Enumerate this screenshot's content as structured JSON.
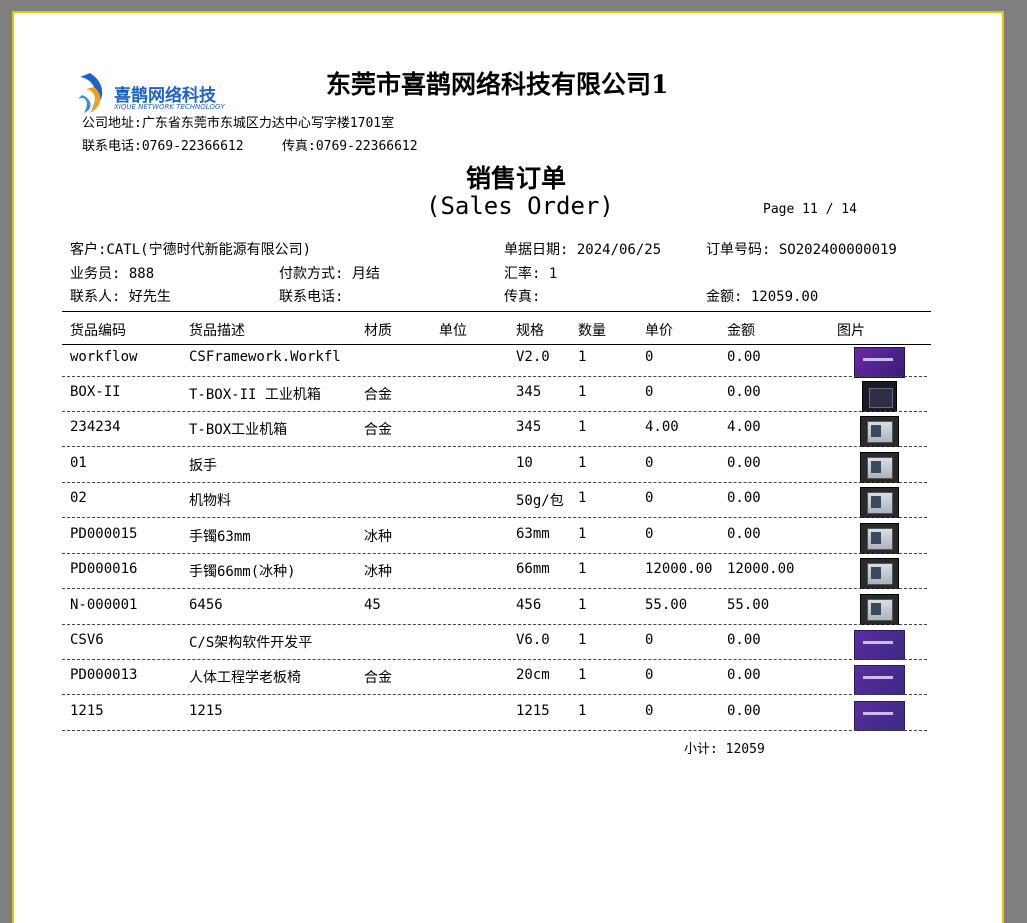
{
  "header": {
    "company_name": "东莞市喜鹊网络科技有限公司1",
    "logo_text_cn": "喜鹊网络科技",
    "logo_text_en": "XIQUE NETWORK TECHNOLOGY",
    "address": "公司地址:广东省东莞市东城区力达中心写字楼1701室",
    "phone": "联系电话:0769-22366612",
    "fax": "传真:0769-22366612"
  },
  "title": {
    "cn": "销售订单",
    "en": "(Sales Order)",
    "page": "Page 11 / 14"
  },
  "info": {
    "customer": "客户:CATL(宁德时代新能源有限公司)",
    "doc_date": "单据日期: 2024/06/25",
    "order_no": "订单号码: SO202400000019",
    "salesman": "业务员: 888",
    "payment": "付款方式: 月结",
    "rate": "汇率: 1",
    "contact": "联系人: 好先生",
    "contact_phone": "联系电话:",
    "fax": "传真:",
    "amount": "金额: 12059.00"
  },
  "columns": [
    "货品编码",
    "货品描述",
    "材质",
    "单位",
    "规格",
    "数量",
    "单价",
    "金额",
    "图片"
  ],
  "rows": [
    {
      "code": "workflow",
      "desc": "CSFramework.Workfl",
      "material": "",
      "unit": "",
      "spec": "V2.0",
      "qty": "1",
      "price": "0",
      "amount": "0.00",
      "image": "purple-banner"
    },
    {
      "code": "BOX-II",
      "desc": "T-BOX-II 工业机箱",
      "material": "合金",
      "unit": "",
      "spec": "345",
      "qty": "1",
      "price": "0",
      "amount": "0.00",
      "image": "dark-box"
    },
    {
      "code": "234234",
      "desc": "T-BOX工业机箱",
      "material": "合金",
      "unit": "",
      "spec": "345",
      "qty": "1",
      "price": "4.00",
      "amount": "4.00",
      "image": "server-box"
    },
    {
      "code": "01",
      "desc": "扳手",
      "material": "",
      "unit": "",
      "spec": "10",
      "qty": "1",
      "price": "0",
      "amount": "0.00",
      "image": "server-box"
    },
    {
      "code": "02",
      "desc": "机物料",
      "material": "",
      "unit": "",
      "spec": "50g/包",
      "qty": "1",
      "price": "0",
      "amount": "0.00",
      "image": "server-box"
    },
    {
      "code": "PD000015",
      "desc": "手镯63mm",
      "material": "冰种",
      "unit": "",
      "spec": "63mm",
      "qty": "1",
      "price": "0",
      "amount": "0.00",
      "image": "server-box"
    },
    {
      "code": "PD000016",
      "desc": "手镯66mm(冰种)",
      "material": "冰种",
      "unit": "",
      "spec": "66mm",
      "qty": "1",
      "price": "12000.00",
      "amount": "12000.00",
      "image": "server-box"
    },
    {
      "code": "N-000001",
      "desc": "6456",
      "material": "45",
      "unit": "",
      "spec": "456",
      "qty": "1",
      "price": "55.00",
      "amount": "55.00",
      "image": "server-box"
    },
    {
      "code": "CSV6",
      "desc": "C/S架构软件开发平",
      "material": "",
      "unit": "",
      "spec": "V6.0",
      "qty": "1",
      "price": "0",
      "amount": "0.00",
      "image": "purple-winform"
    },
    {
      "code": "PD000013",
      "desc": "人体工程学老板椅",
      "material": "合金",
      "unit": "",
      "spec": "20cm",
      "qty": "1",
      "price": "0",
      "amount": "0.00",
      "image": "purple-winform"
    },
    {
      "code": "1215",
      "desc": "1215",
      "material": "",
      "unit": "",
      "spec": "1215",
      "qty": "1",
      "price": "0",
      "amount": "0.00",
      "image": "purple-winform"
    }
  ],
  "subtotal": "小计: 12059",
  "colors": {
    "page_border": "#e8c300",
    "background": "#7f7f7f",
    "logo_blue": "#1e63c6"
  }
}
